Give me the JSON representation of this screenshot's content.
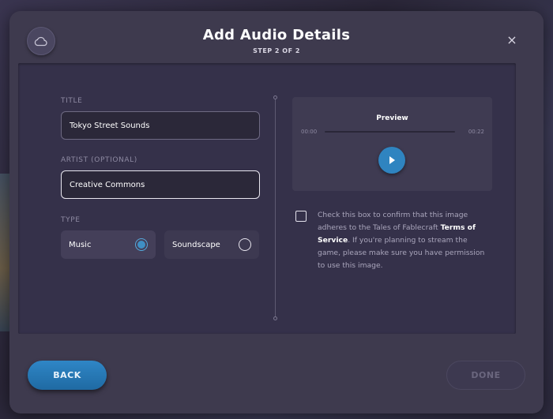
{
  "modal": {
    "title": "Add Audio Details",
    "step": "STEP 2 OF 2",
    "close_glyph": "×"
  },
  "form": {
    "title_label": "TITLE",
    "title_value": "Tokyo Street Sounds",
    "artist_label": "ARTIST (OPTIONAL)",
    "artist_value": "Creative Commons",
    "type_label": "TYPE",
    "type_options": [
      {
        "label": "Music",
        "selected": true
      },
      {
        "label": "Soundscape",
        "selected": false
      }
    ]
  },
  "preview": {
    "title": "Preview",
    "current_time": "00:00",
    "duration": "00:22",
    "progress": 0
  },
  "consent": {
    "checked": false,
    "text_before": "Check this box to confirm that this image adheres to the Tales of Fablecraft ",
    "link_text": "Terms of Service",
    "text_after": ". If you're planning to stream the game, please make sure you have permission to use this image."
  },
  "footer": {
    "back_label": "BACK",
    "done_label": "DONE"
  },
  "colors": {
    "accent": "#2f84c0",
    "modal_bg": "#3e3a4e",
    "panel_bg": "#35314a"
  },
  "icons": {
    "cloud": "cloud-icon",
    "close": "close-icon",
    "play": "play-icon"
  }
}
